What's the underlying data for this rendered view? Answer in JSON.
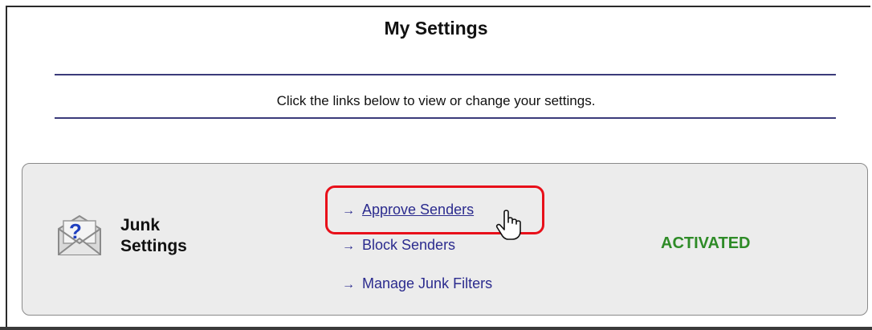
{
  "page": {
    "title": "My Settings",
    "instructions": "Click the links below to view or change your settings."
  },
  "junk_settings": {
    "icon": "question-envelope-icon",
    "title_line1": "Junk",
    "title_line2": "Settings",
    "links": [
      {
        "arrow": "→",
        "label": "Approve Senders"
      },
      {
        "arrow": "→",
        "label": "Block Senders"
      },
      {
        "arrow": "→",
        "label": "Manage Junk Filters"
      }
    ],
    "status": "ACTIVATED",
    "status_color": "#2e8b27",
    "highlight_color": "#e8101a",
    "link_color": "#2b2b8e"
  }
}
